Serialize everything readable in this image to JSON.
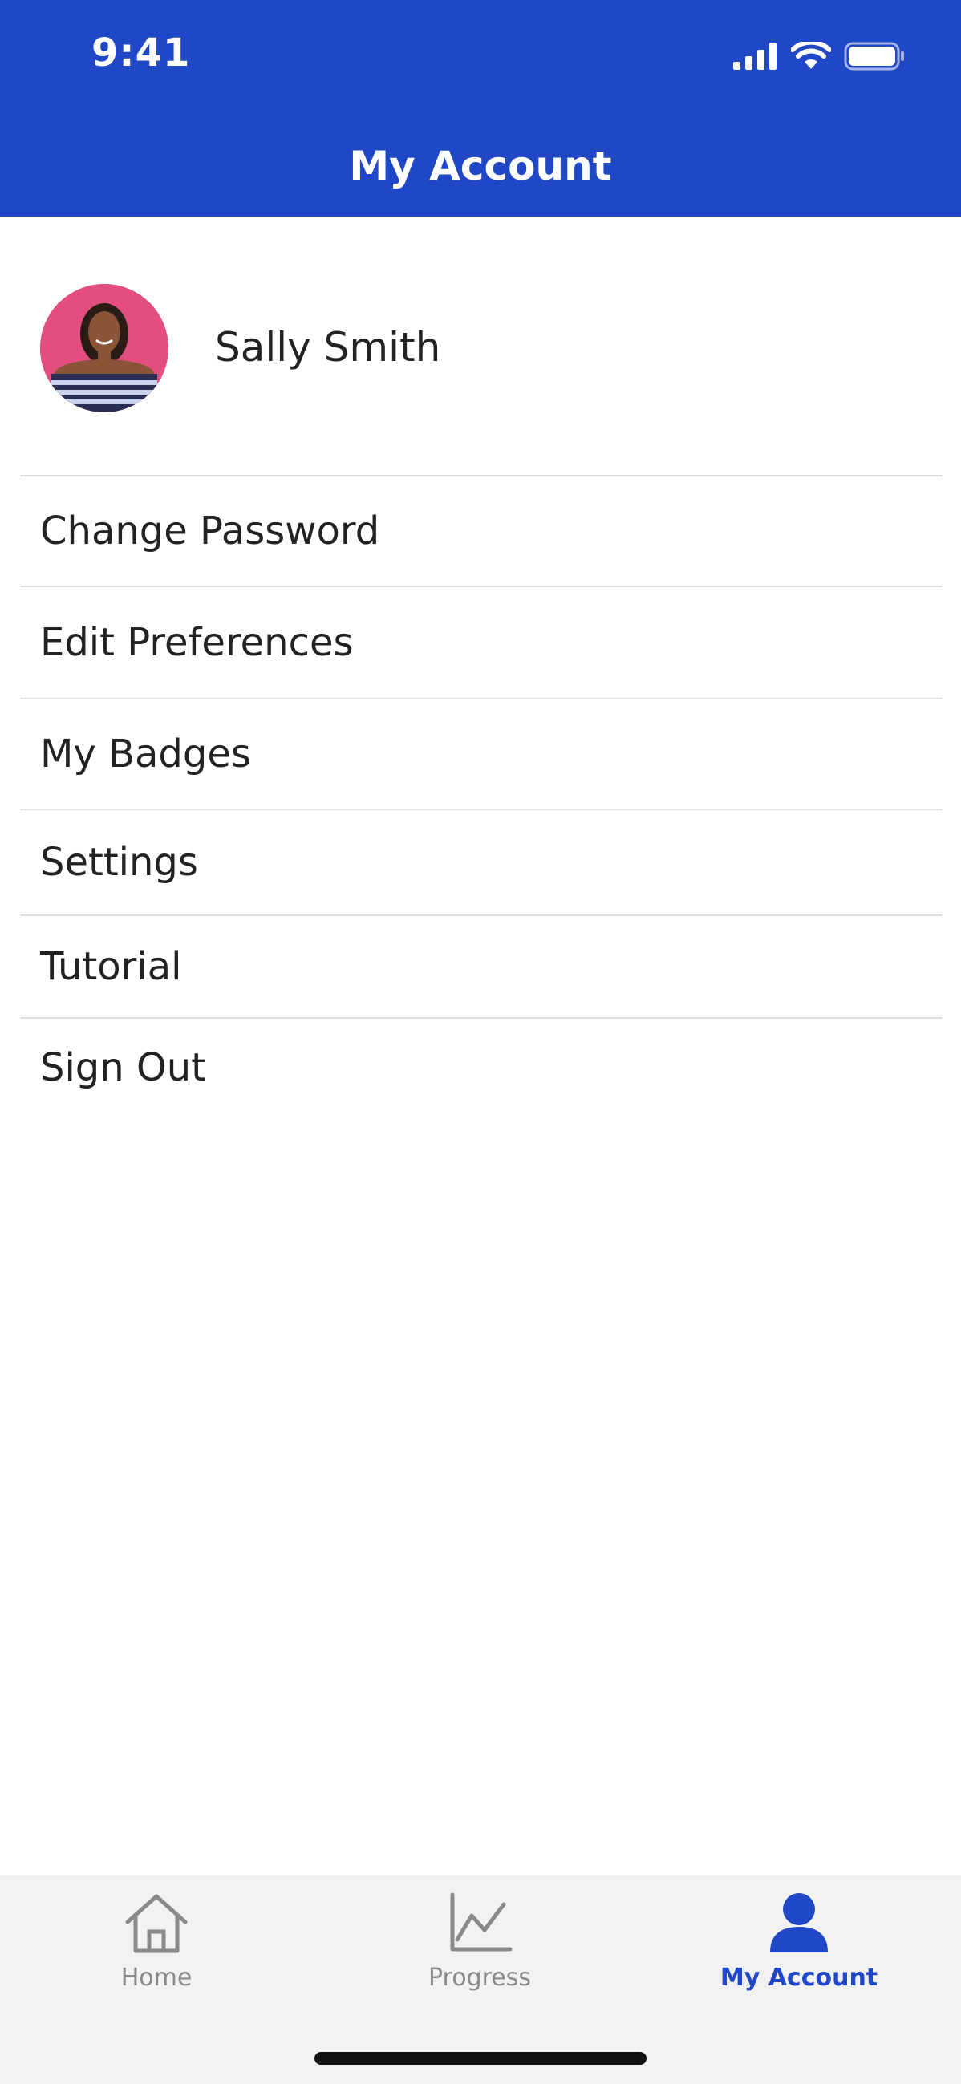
{
  "status_bar": {
    "time": "9:41",
    "icons": [
      "signal-icon",
      "wifi-icon",
      "battery-icon"
    ]
  },
  "header": {
    "title": "My Account",
    "background_color": "#2047c6"
  },
  "profile": {
    "name": "Sally Smith"
  },
  "menu": {
    "items": [
      {
        "label": "Change Password"
      },
      {
        "label": "Edit Preferences"
      },
      {
        "label": "My Badges"
      },
      {
        "label": "Settings"
      },
      {
        "label": "Tutorial"
      },
      {
        "label": "Sign Out"
      }
    ]
  },
  "tabbar": {
    "tabs": [
      {
        "label": "Home",
        "icon": "home-icon",
        "active": false
      },
      {
        "label": "Progress",
        "icon": "chart-icon",
        "active": false
      },
      {
        "label": "My Account",
        "icon": "user-icon",
        "active": true
      }
    ],
    "active_color": "#2047c6",
    "inactive_color": "#8a8a8a"
  }
}
